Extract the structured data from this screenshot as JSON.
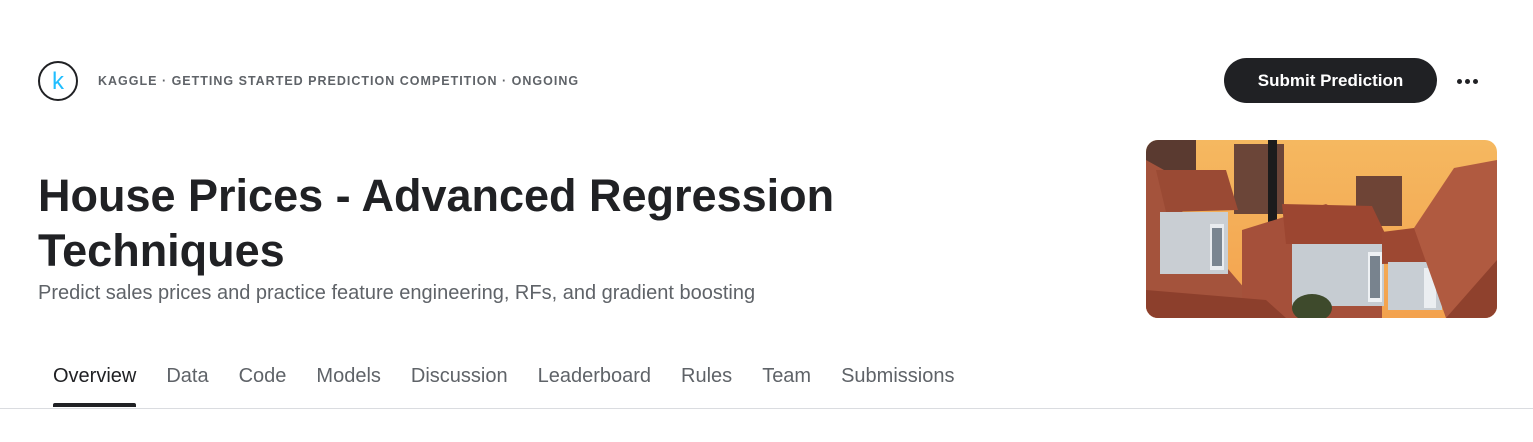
{
  "header": {
    "logo_letter": "k",
    "meta": "KAGGLE · GETTING STARTED PREDICTION COMPETITION · ONGOING",
    "submit_label": "Submit Prediction",
    "more_icon": "more-horizontal-icon"
  },
  "competition": {
    "title": "House Prices - Advanced Regression Techniques",
    "subtitle": "Predict sales prices and practice feature engineering, RFs, and gradient boosting"
  },
  "tabs": [
    {
      "label": "Overview",
      "active": true
    },
    {
      "label": "Data",
      "active": false
    },
    {
      "label": "Code",
      "active": false
    },
    {
      "label": "Models",
      "active": false
    },
    {
      "label": "Discussion",
      "active": false
    },
    {
      "label": "Leaderboard",
      "active": false
    },
    {
      "label": "Rules",
      "active": false
    },
    {
      "label": "Team",
      "active": false
    },
    {
      "label": "Submissions",
      "active": false
    }
  ],
  "colors": {
    "text_primary": "#202124",
    "text_secondary": "#5f6368",
    "kaggle_blue": "#20beff",
    "divider": "#dadce0"
  }
}
